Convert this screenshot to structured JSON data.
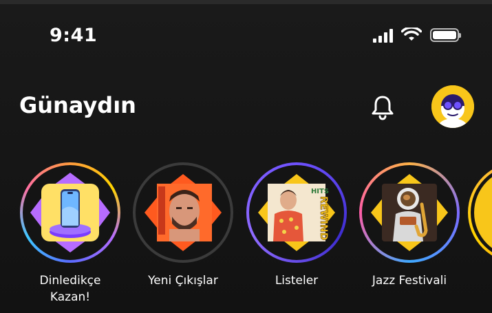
{
  "status_bar": {
    "time": "9:41",
    "icons": [
      "cellular-signal-icon",
      "wifi-icon",
      "battery-icon"
    ]
  },
  "header": {
    "greeting": "Günaydın",
    "notification_icon": "bell-icon",
    "avatar_icon": "avatar-icon"
  },
  "stories": [
    {
      "label": "Dinledikçe\nKazan!",
      "thumb": "phone-prize"
    },
    {
      "label": "Yeni Çıkışlar",
      "thumb": "artist-portrait"
    },
    {
      "label": "Listeler",
      "thumb": "hits-rewind",
      "badge": "HITS REWIND"
    },
    {
      "label": "Jazz Festivali",
      "thumb": "astronaut-sax"
    }
  ],
  "colors": {
    "background": "#161616",
    "accent_yellow": "#f8c61a",
    "accent_orange": "#ff5a1f",
    "accent_purple": "#6f52ff"
  }
}
